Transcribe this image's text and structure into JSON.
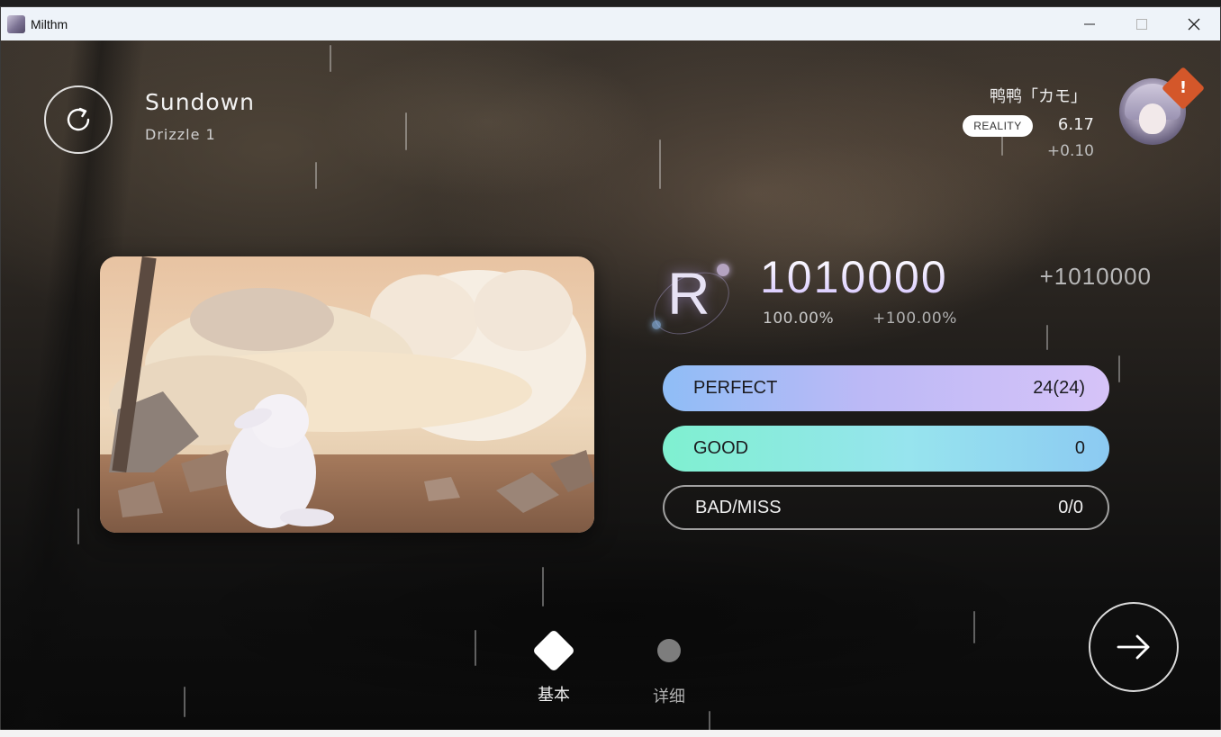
{
  "window": {
    "title": "Milthm",
    "controls": [
      "minimize-icon",
      "maximize-icon",
      "close-icon"
    ]
  },
  "song": {
    "title": "Sundown",
    "difficulty": "Drizzle 1"
  },
  "player": {
    "name": "鸭鸭「カモ」",
    "badge": "REALITY",
    "rating": "6.17",
    "rating_delta": "+0.10",
    "alert": "!"
  },
  "result": {
    "rank": "R",
    "score": "1010000",
    "score_delta": "+1010000",
    "accuracy": "100.00%",
    "accuracy_delta": "+100.00%",
    "judgements": [
      {
        "label": "PERFECT",
        "value": "24(24)"
      },
      {
        "label": "GOOD",
        "value": "0"
      },
      {
        "label": "BAD/MISS",
        "value": "0/0"
      }
    ]
  },
  "tabs": [
    {
      "label": "基本",
      "active": true
    },
    {
      "label": "详细",
      "active": false
    }
  ],
  "icons": {
    "retry": "retry-icon",
    "next": "arrow-right-icon"
  },
  "colors": {
    "perfect_gradient": [
      "#8fbdf6",
      "#d6c3f8"
    ],
    "good_gradient": [
      "#7ff0d0",
      "#8ccaf2"
    ],
    "alert": "#d4572a"
  }
}
